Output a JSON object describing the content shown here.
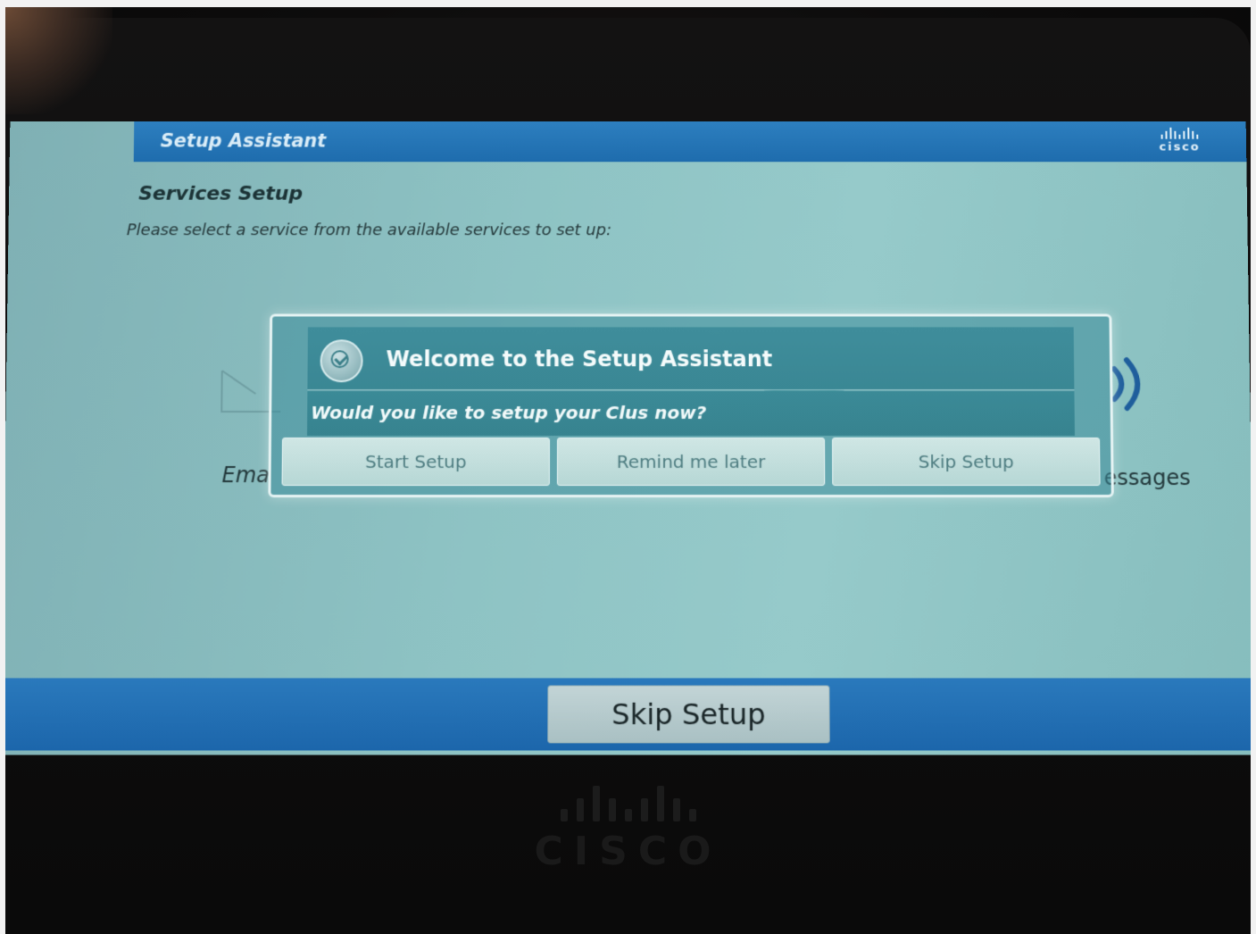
{
  "screen": {
    "title_bar": {
      "title": "Setup Assistant",
      "logo_text": "cisco"
    },
    "page": {
      "heading": "Services Setup",
      "subtitle": "Please select a service from the available services to set up:"
    },
    "services": [
      {
        "label": "Ema",
        "icon": "envelope-icon"
      },
      {
        "label": "essages",
        "icon": "voicemail-icon"
      }
    ],
    "bottom_bar": {
      "skip_label": "Skip Setup"
    }
  },
  "modal": {
    "title": "Welcome to the Setup Assistant",
    "question": "Would you like to setup your Clus now?",
    "buttons": {
      "start": "Start Setup",
      "remind": "Remind me later",
      "skip": "Skip Setup"
    }
  },
  "device": {
    "logo_text": "CISCO"
  },
  "colors": {
    "title_bar": "#1e6cad",
    "screen_bg": "#8ec3c4",
    "modal_bg": "#3a8794",
    "button_bg": "#c2d9d7"
  }
}
